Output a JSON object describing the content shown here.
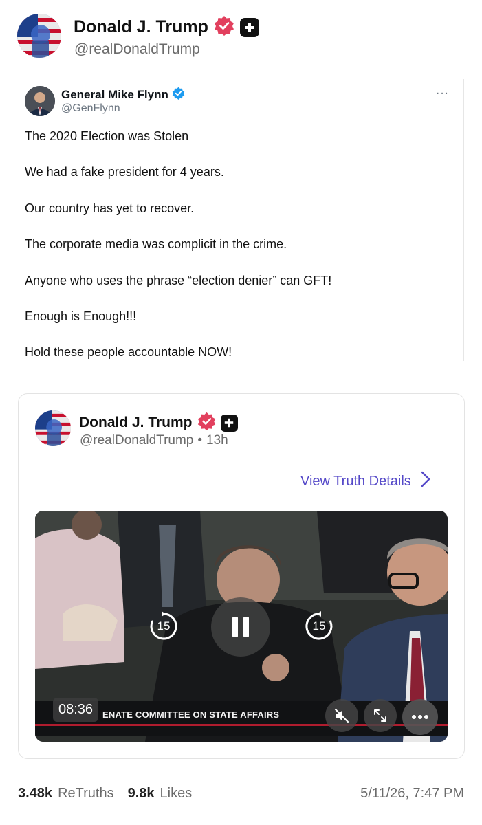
{
  "post": {
    "author_name": "Donald J. Trump",
    "author_handle": "@realDonaldTrump",
    "icons": [
      "verified-badge-icon",
      "plus-badge-icon"
    ]
  },
  "quoted_x_post": {
    "author_name": "General Mike Flynn",
    "author_handle": "@GenFlynn",
    "more_label": "···",
    "lines": [
      "The 2020 Election was Stolen",
      "We had a fake president for 4 years.",
      "Our country has yet to recover.",
      "The corporate media was complicit in the crime.",
      "Anyone who uses the phrase “election denier” can GFT!",
      "Enough is Enough!!!",
      "Hold these people accountable NOW!"
    ]
  },
  "embedded_truth": {
    "author_name": "Donald J. Trump",
    "author_handle": "@realDonaldTrump",
    "time_ago": "13h",
    "separator": "•",
    "view_details_label": "View Truth Details",
    "video": {
      "duration": "08:36",
      "caption": "ENATE COMMITTEE ON STATE AFFAIRS",
      "rewind_label": "15",
      "forward_label": "15",
      "state": "playing"
    }
  },
  "stats": {
    "retruths_count": "3.48k",
    "retruths_label": "ReTruths",
    "likes_count": "9.8k",
    "likes_label": "Likes",
    "timestamp": "5/11/26, 7:47 PM"
  },
  "colors": {
    "accent_purple": "#5448c8",
    "verified_pink": "#e2405e",
    "x_verified_blue": "#1d9bf0"
  }
}
